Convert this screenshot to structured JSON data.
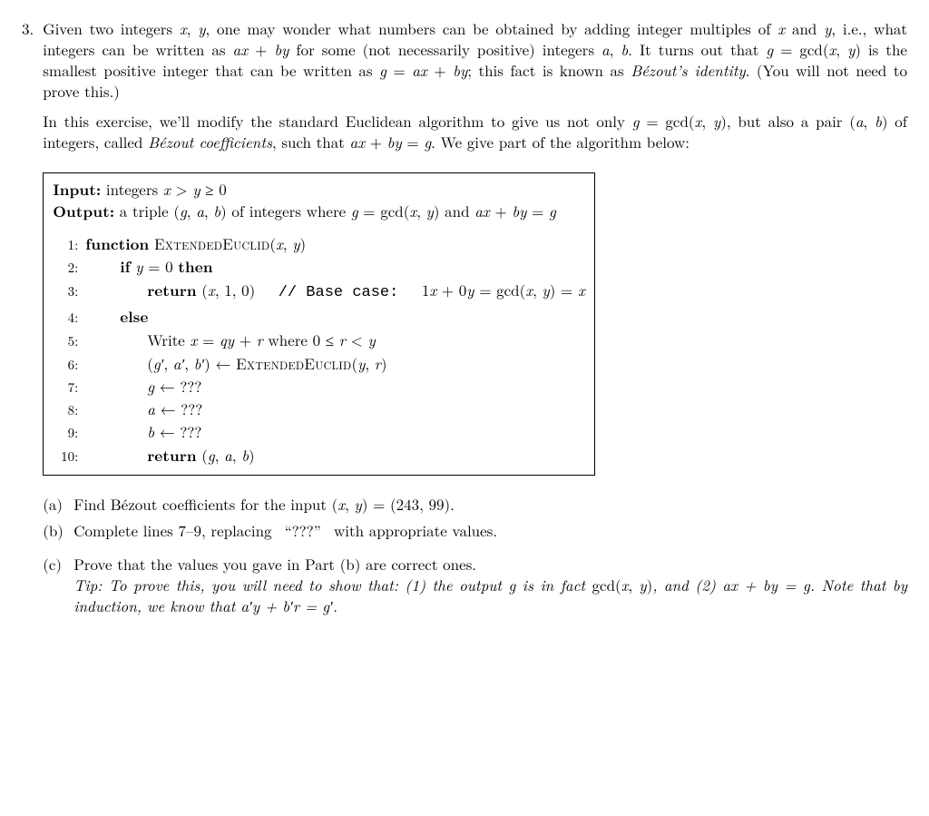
{
  "problem_number": "3.",
  "para1": "Given two integers x, y, one may wonder what numbers can be obtained by adding integer multiples of x and y, i.e., what integers can be written as ax + by for some (not necessarily positive) integers a, b. It turns out that g = gcd(x, y) is the smallest positive integer that can be written as g = ax + by; this fact is known as Bézout's identity. (You will not need to prove this.)",
  "para2": "In this exercise, we'll modify the standard Euclidean algorithm to give us not only g = gcd(x, y), but also a pair (a, b) of integers, called Bézout coefficients, such that ax + by = g. We give part of the algorithm below:",
  "input_label": "Input:",
  "input_text": "integers x > y ≥ 0",
  "output_label": "Output:",
  "output_text": "a triple (g, a, b) of integers where g = gcd(x, y) and ax + by = g",
  "algo": {
    "l1": "function ExtendedEuclid(x, y)",
    "l2": "if y = 0 then",
    "l3a": "return (x, 1, 0)",
    "l3b": "// Base case:",
    "l3c": "1x + 0y = gcd(x, y) = x",
    "l4": "else",
    "l5": "Write x = qy + r where 0 ≤ r < y",
    "l6": "(g′, a′, b′) ← ExtendedEuclid(y, r)",
    "l7": "g ← ???",
    "l8": "a ← ???",
    "l9": "b ← ???",
    "l10": "return (g, a, b)"
  },
  "ln": {
    "n1": "1:",
    "n2": "2:",
    "n3": "3:",
    "n4": "4:",
    "n5": "5:",
    "n6": "6:",
    "n7": "7:",
    "n8": "8:",
    "n9": "9:",
    "n10": "10:"
  },
  "parts": {
    "a_label": "(a)",
    "a_text": "Find Bézout coefficients for the input (x, y) = (243, 99).",
    "b_label": "(b)",
    "b_text": "Complete lines 7–9, replacing “???” with appropriate values.",
    "c_label": "(c)",
    "c_text": "Prove that the values you gave in Part (b) are correct ones.",
    "c_tip": "Tip: To prove this, you will need to show that: (1) the output g is in fact gcd(x, y), and (2) ax + by = g. Note that by induction, we know that a′y + b′r = g′."
  }
}
